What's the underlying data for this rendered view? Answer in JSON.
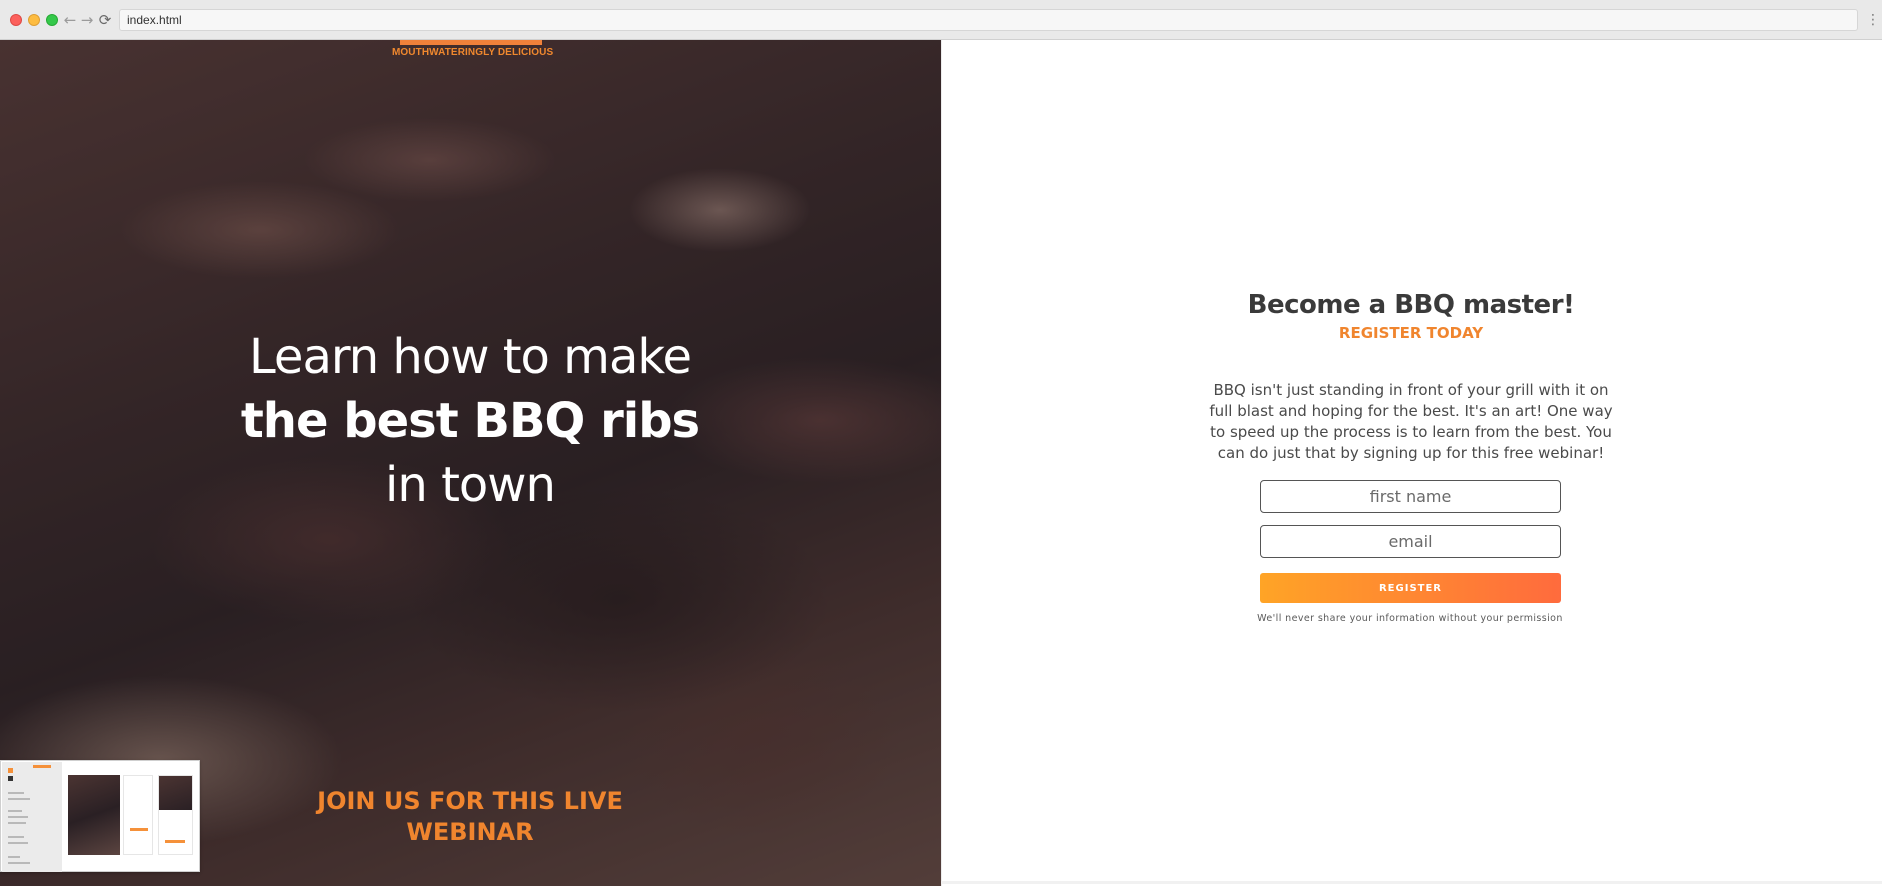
{
  "browser": {
    "url": "index.html",
    "nav": {
      "back": "←",
      "forward": "→",
      "reload": "⟳",
      "menu": "⋮"
    }
  },
  "hero": {
    "eyebrow": "MOUTHWATERINGLY DELICIOUS",
    "headline": {
      "part1": "Learn how to make ",
      "bold1": "the best BBQ ribs",
      "part2": " in town"
    },
    "cta": "JOIN US FOR THIS LIVE WEBINAR"
  },
  "form": {
    "title": "Become a BBQ master!",
    "subtitle": "REGISTER TODAY",
    "body": "BBQ isn't just standing in front of your grill with it on full blast and hoping for the best. It's an art! One way to speed up the process is to learn from the best. You can do just that by signing up for this free webinar!",
    "first_name_placeholder": "first name",
    "email_placeholder": "email",
    "register_label": "REGISTER",
    "privacy": "We'll never share your information without your permission"
  },
  "colors": {
    "accent": "#f0852e",
    "button_start": "#ffa426",
    "button_end": "#ff6b3d",
    "heading": "#3a3a3a"
  }
}
